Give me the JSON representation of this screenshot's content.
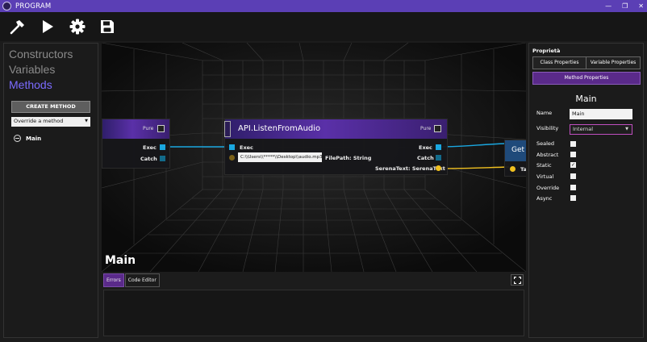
{
  "window": {
    "title": "PROGRAM",
    "minimize": "—",
    "restore": "❐",
    "close": "✕"
  },
  "toolbar": {
    "build": "hammer-icon",
    "run": "play-icon",
    "settings": "gear-icon",
    "save": "save-icon"
  },
  "left_panel": {
    "tab_constructors": "Constructors",
    "tab_variables": "Variables",
    "tab_methods": "Methods",
    "create_button": "CREATE METHOD",
    "override_select": "Override a method",
    "methods": [
      {
        "name": "Main"
      }
    ]
  },
  "canvas": {
    "left_node": {
      "pure_label": "Pure",
      "exec": "Exec",
      "catch": "Catch"
    },
    "api_node": {
      "title": "API.ListenFromAudio",
      "pure_label": "Pure",
      "exec_in": "Exec",
      "exec_out": "Exec",
      "catch": "Catch",
      "path_value": "C:\\\\Users\\\\*****\\\\Desktop\\\\audio.mp3",
      "path_label": "FilePath: String",
      "output_label": "SerenaText: SerenaText"
    },
    "right_node": {
      "title": "Get t",
      "output": "Ta"
    },
    "colors": {
      "exec": "#1aa7e0",
      "string": "#f0c020",
      "accent": "#5b3fb5"
    }
  },
  "method_title": "Main",
  "bottom_panel": {
    "tab_errors": "Errors",
    "tab_code_editor": "Code Editor"
  },
  "right_panel": {
    "title": "Proprietà",
    "tab_class_properties": "Class Properties",
    "tab_variable_properties": "Variable Properties",
    "tab_method_properties": "Method Properties",
    "heading": "Main",
    "name_label": "Name",
    "name_value": "Main",
    "visibility_label": "Visibility",
    "visibility_value": "Internal",
    "flags": [
      {
        "label": "Sealed",
        "checked": false
      },
      {
        "label": "Abstract",
        "checked": false
      },
      {
        "label": "Static",
        "checked": true
      },
      {
        "label": "Virtual",
        "checked": false
      },
      {
        "label": "Override",
        "checked": false
      },
      {
        "label": "Async",
        "checked": false
      }
    ]
  }
}
